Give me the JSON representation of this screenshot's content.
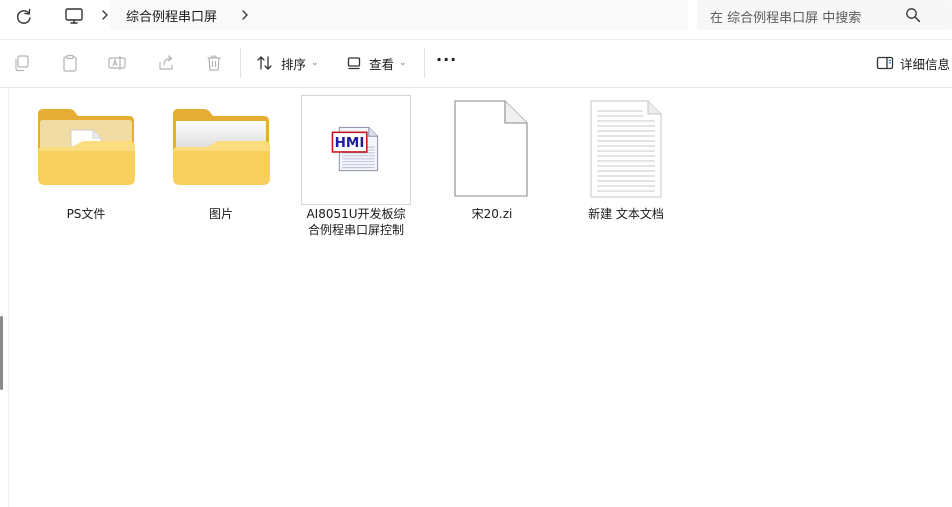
{
  "address_bar": {
    "breadcrumb": "综合例程串口屏",
    "search_placeholder": "在 综合例程串口屏 中搜索"
  },
  "toolbar": {
    "sort_label": "排序",
    "view_label": "查看",
    "details_label": "详细信息"
  },
  "files": [
    {
      "name": "PS文件",
      "type": "folder"
    },
    {
      "name": "图片",
      "type": "folder"
    },
    {
      "name": "AI8051U开发板综合例程串口屏控制",
      "line1": "AI8051U开发板综",
      "line2": "合例程串口屏控制",
      "type": "hmi-file",
      "badge": "HMI"
    },
    {
      "name": "宋20.zi",
      "type": "blank-file"
    },
    {
      "name": "新建 文本文档",
      "type": "text-file"
    }
  ],
  "colors": {
    "folder_back": "#e8b13a",
    "folder_front": "#f9d56d",
    "hmi_badge": "#c4161c"
  }
}
